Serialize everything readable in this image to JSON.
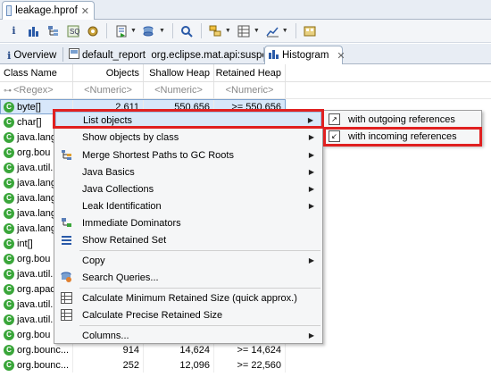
{
  "editor_tab": {
    "label": "leakage.hprof",
    "close": "✕"
  },
  "toolbar": {
    "buttons": [
      {
        "name": "info-icon",
        "glyph": "i"
      },
      {
        "name": "histogram-icon",
        "glyph": "▮"
      },
      {
        "name": "dominator-tree-icon",
        "glyph": "▦"
      },
      {
        "name": "oql-icon",
        "glyph": "≣"
      },
      {
        "name": "gear-icon",
        "glyph": "⚙"
      },
      {
        "name": "run-report-icon",
        "glyph": "▤"
      },
      {
        "name": "query-browser-icon",
        "glyph": "⛁"
      },
      {
        "name": "search-icon",
        "glyph": "⌕"
      },
      {
        "name": "group-icon",
        "glyph": "▣"
      },
      {
        "name": "calculate-icon",
        "glyph": "▥"
      },
      {
        "name": "export-icon",
        "glyph": "⇗"
      },
      {
        "name": "pin-icon",
        "glyph": "⌘"
      }
    ]
  },
  "report_tabs": [
    {
      "label": "Overview",
      "icon": "i"
    },
    {
      "label": "default_report  org.eclipse.mat.api:suspects",
      "icon": "▣"
    },
    {
      "label": "Histogram",
      "icon": "▮",
      "close": "✕"
    }
  ],
  "table": {
    "headers": [
      "Class Name",
      "Objects",
      "Shallow Heap",
      "Retained Heap"
    ],
    "filters": [
      "<Regex>",
      "<Numeric>",
      "<Numeric>",
      "<Numeric>"
    ],
    "rows": [
      {
        "name": "byte[]",
        "objects": "2,611",
        "shallow": "550,656",
        "retained": ">= 550,656",
        "selected": true
      },
      {
        "name": "char[]",
        "objects": "",
        "shallow": "",
        "retained": ""
      },
      {
        "name": "java.lang",
        "objects": "",
        "shallow": "",
        "retained": ""
      },
      {
        "name": "org.bou",
        "objects": "",
        "shallow": "",
        "retained": ""
      },
      {
        "name": "java.util.",
        "objects": "",
        "shallow": "",
        "retained": ""
      },
      {
        "name": "java.lang",
        "objects": "",
        "shallow": "",
        "retained": ""
      },
      {
        "name": "java.lang",
        "objects": "",
        "shallow": "",
        "retained": ""
      },
      {
        "name": "java.lang",
        "objects": "",
        "shallow": "",
        "retained": ""
      },
      {
        "name": "java.lang",
        "objects": "",
        "shallow": "",
        "retained": ""
      },
      {
        "name": "int[]",
        "objects": "",
        "shallow": "",
        "retained": ""
      },
      {
        "name": "org.bou",
        "objects": "",
        "shallow": "",
        "retained": ""
      },
      {
        "name": "java.util.",
        "objects": "",
        "shallow": "",
        "retained": ""
      },
      {
        "name": "org.apac",
        "objects": "",
        "shallow": "",
        "retained": ""
      },
      {
        "name": "java.util.",
        "objects": "",
        "shallow": "",
        "retained": ""
      },
      {
        "name": "java.util.",
        "objects": "",
        "shallow": "",
        "retained": ""
      },
      {
        "name": "org.bou",
        "objects": "",
        "shallow": "",
        "retained": ""
      },
      {
        "name": "org.bounc...",
        "objects": "914",
        "shallow": "14,624",
        "retained": ">= 14,624"
      },
      {
        "name": "org.bounc...",
        "objects": "252",
        "shallow": "12,096",
        "retained": ">= 22,560"
      }
    ]
  },
  "context_menu": {
    "items": [
      {
        "label": "List objects",
        "submenu": true,
        "icon": "",
        "active": true
      },
      {
        "label": "Show objects by class",
        "submenu": true,
        "icon": ""
      },
      {
        "label": "Merge Shortest Paths to GC Roots",
        "submenu": true,
        "icon": "⋮"
      },
      {
        "label": "Java Basics",
        "submenu": true,
        "icon": ""
      },
      {
        "label": "Java Collections",
        "submenu": true,
        "icon": ""
      },
      {
        "label": "Leak Identification",
        "submenu": true,
        "icon": ""
      },
      {
        "label": "Immediate Dominators",
        "submenu": false,
        "icon": "⋮"
      },
      {
        "label": "Show Retained Set",
        "submenu": false,
        "icon": "≡"
      },
      {
        "label": "Copy",
        "submenu": true,
        "icon": ""
      },
      {
        "label": "Search Queries...",
        "submenu": false,
        "icon": "⚙"
      },
      {
        "label": "Calculate Minimum Retained Size (quick approx.)",
        "submenu": false,
        "icon": "▦"
      },
      {
        "label": "Calculate Precise Retained Size",
        "submenu": false,
        "icon": "▦"
      },
      {
        "label": "Columns...",
        "submenu": true,
        "icon": ""
      }
    ]
  },
  "submenu": {
    "items": [
      {
        "label": "with outgoing references",
        "icon": "↗"
      },
      {
        "label": "with incoming references",
        "icon": "↙",
        "highlighted": true
      }
    ]
  },
  "colors": {
    "highlight_box": "#e02020",
    "class_icon": "#3aa63a",
    "selection": "#d7e7fa"
  }
}
